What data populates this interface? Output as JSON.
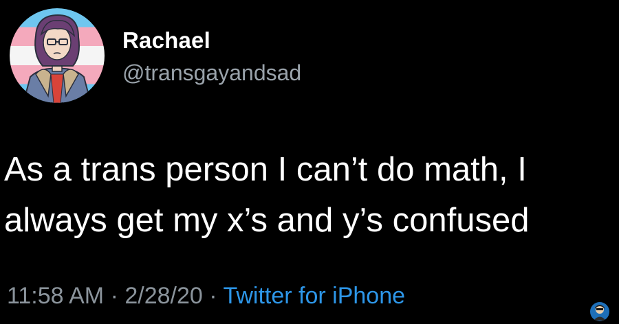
{
  "user": {
    "display_name": "Rachael",
    "handle": "@transgayandsad"
  },
  "tweet": {
    "lines": [
      "As a trans person I can’t do math, I",
      "always get my x’s and y’s confused"
    ],
    "time": "11:58 AM",
    "date": "2/28/20",
    "separator": "·",
    "source": "Twitter for iPhone"
  },
  "icons": {
    "avatar": "avatar-trans-flag-portrait",
    "watermark": "watermark-logo-icon"
  },
  "colors": {
    "background": "#000000",
    "text": "#ffffff",
    "secondary_text": "#8b949c",
    "link": "#2d96e8",
    "flag_blue": "#6ec6ef",
    "flag_pink": "#f4a9bc",
    "flag_white": "#f5f5f5"
  }
}
